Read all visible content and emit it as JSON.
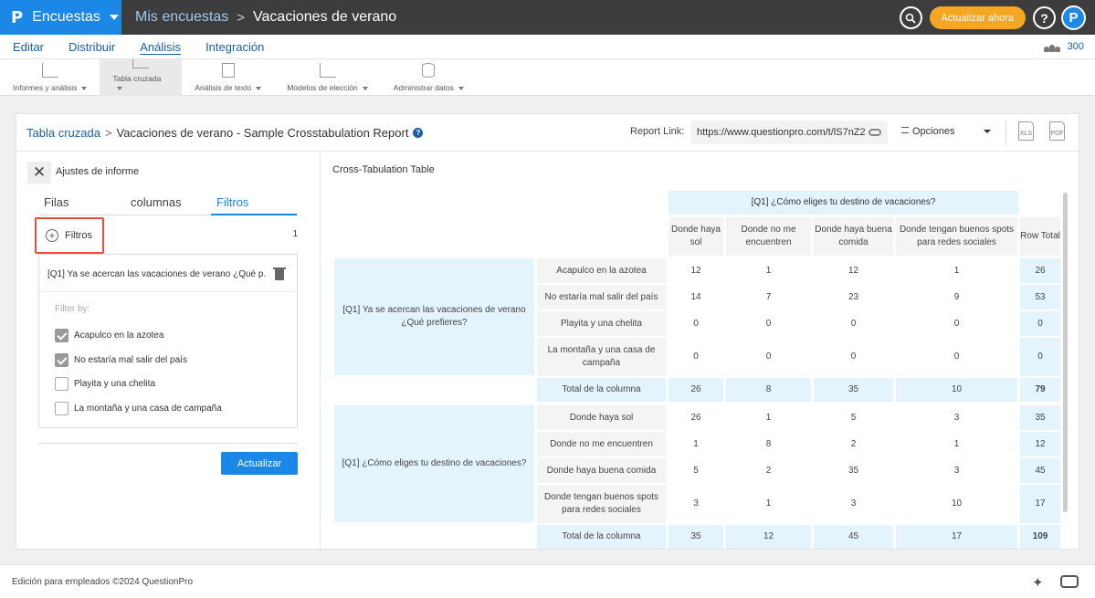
{
  "brand": {
    "logo": "P",
    "name": "Encuestas"
  },
  "crumbs": {
    "parent": "Mis encuestas",
    "sep": ">",
    "current": "Vacaciones de verano"
  },
  "top_right": {
    "search_icon": "search-icon",
    "upgrade_label": "Actualizar ahora",
    "help_label": "?",
    "avatar_label": "P"
  },
  "nav": {
    "items": [
      "Editar",
      "Distribuir",
      "Análisis",
      "Integración"
    ],
    "active": "Análisis",
    "right_count": "300"
  },
  "toolbar": {
    "items": [
      {
        "label": "Informes y análisis",
        "icon": "line-chart-icon"
      },
      {
        "label": "Tabla cruzada",
        "icon": "crosstab-chart-icon",
        "active": true
      },
      {
        "label": "Análisis de texto",
        "icon": "text-grid-icon"
      },
      {
        "label": "Modelos de elección",
        "icon": "bar-chart-icon"
      },
      {
        "label": "Administrar datos",
        "icon": "database-icon"
      }
    ]
  },
  "header": {
    "bc_link": "Tabla cruzada",
    "bc_sep": ">",
    "bc_current": "Vacaciones de verano - Sample Crosstabulation Report",
    "help": "?",
    "report_link_label": "Report Link:",
    "report_url": "https://www.questionpro.com/t/lS7nZ2",
    "options_label": "Opciones",
    "xls_label": "XLS",
    "pdf_label": "PDF"
  },
  "panel": {
    "title": "Ajustes de informe",
    "tabs": [
      "Filas",
      "columnas",
      "Filtros"
    ],
    "filtros_label": "Filtros",
    "filtros_count": "1",
    "filter_question": "[Q1] Ya se acercan las vacaciones de verano ¿Qué p...",
    "filter_by": "Filter by:",
    "options": [
      {
        "label": "Acapulco en la azotea",
        "checked": true
      },
      {
        "label": "No estaría mal salir del país",
        "checked": true
      },
      {
        "label": "Playita y una chelita",
        "checked": false
      },
      {
        "label": "La montaña y una casa de campaña",
        "checked": false
      }
    ],
    "update_label": "Actualizar"
  },
  "table": {
    "title": "Cross-Tabulation Table",
    "col_question": "[Q1] ¿Cómo eliges tu destino de vacaciones?",
    "col_headers": [
      "Donde haya sol",
      "Donde no me encuentren",
      "Donde haya buena comida",
      "Donde tengan buenos spots para redes sociales"
    ],
    "row_total_header": "Row Total",
    "groups": [
      {
        "question": "[Q1] Ya se acercan las vacaciones de verano ¿Qué prefieres?",
        "rows": [
          {
            "label": "Acapulco en la azotea",
            "values": [
              "12",
              "1",
              "12",
              "1"
            ],
            "total": "26"
          },
          {
            "label": "No estaría mal salir del país",
            "values": [
              "14",
              "7",
              "23",
              "9"
            ],
            "total": "53"
          },
          {
            "label": "Playita y una chelita",
            "values": [
              "0",
              "0",
              "0",
              "0"
            ],
            "total": "0"
          },
          {
            "label": "La montaña y una casa de campaña",
            "values": [
              "0",
              "0",
              "0",
              "0"
            ],
            "total": "0"
          }
        ],
        "total_label": "Total de la columna",
        "totals": [
          "26",
          "8",
          "35",
          "10"
        ],
        "grand_total": "79"
      },
      {
        "question": "[Q1] ¿Cómo eliges tu destino de vacaciones?",
        "rows": [
          {
            "label": "Donde haya sol",
            "values": [
              "26",
              "1",
              "5",
              "3"
            ],
            "total": "35"
          },
          {
            "label": "Donde no me encuentren",
            "values": [
              "1",
              "8",
              "2",
              "1"
            ],
            "total": "12"
          },
          {
            "label": "Donde haya buena comida",
            "values": [
              "5",
              "2",
              "35",
              "3"
            ],
            "total": "45"
          },
          {
            "label": "Donde tengan buenos spots para redes sociales",
            "values": [
              "3",
              "1",
              "3",
              "10"
            ],
            "total": "17"
          }
        ],
        "total_label": "Total de la columna",
        "totals": [
          "35",
          "12",
          "45",
          "17"
        ],
        "grand_total": "109"
      }
    ]
  },
  "footer": {
    "text": "Edición para empleados ©2024 QuestionPro"
  }
}
